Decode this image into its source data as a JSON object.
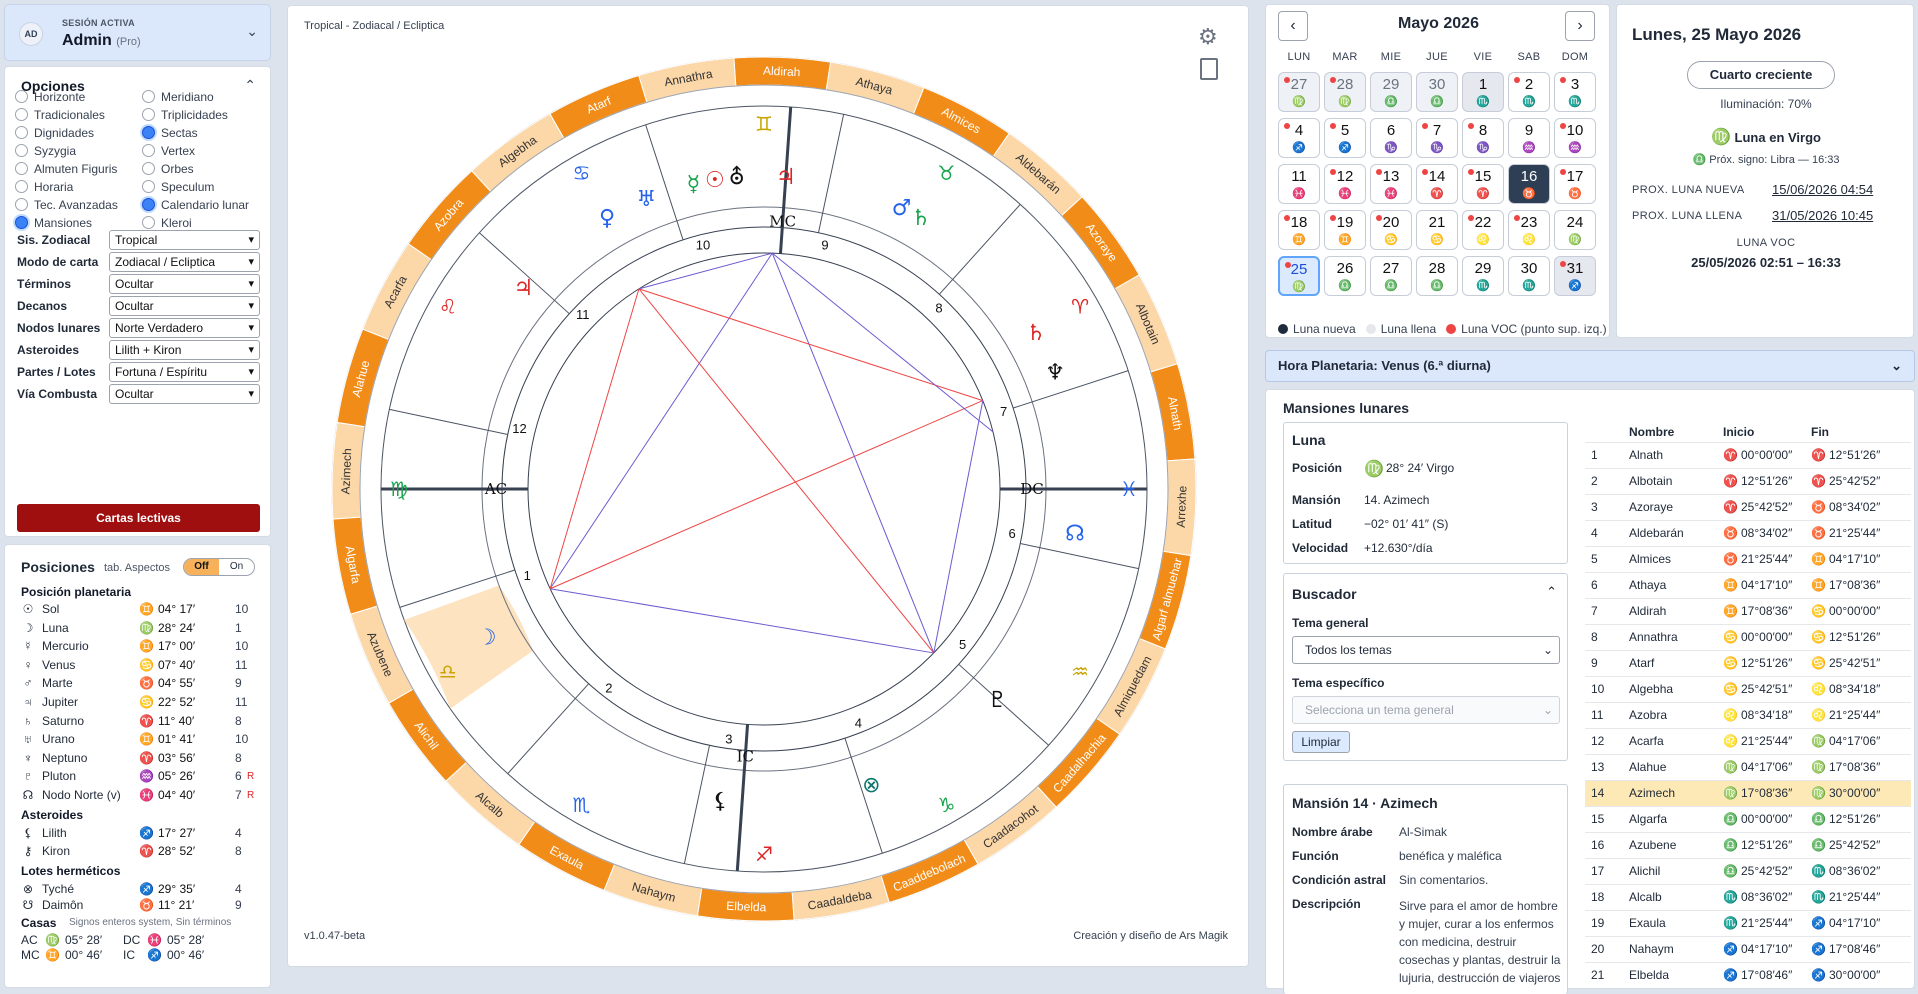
{
  "session": {
    "initials": "AD",
    "label": "SESIÓN ACTIVA",
    "user": "Admin",
    "role": "(Pro)"
  },
  "options": {
    "title": "Opciones",
    "items": [
      {
        "label": "Horizonte",
        "on": false
      },
      {
        "label": "Meridiano",
        "on": false
      },
      {
        "label": "Tradicionales",
        "on": false
      },
      {
        "label": "Triplicidades",
        "on": false
      },
      {
        "label": "Dignidades",
        "on": false
      },
      {
        "label": "Sectas",
        "on": true
      },
      {
        "label": "Syzygia",
        "on": false
      },
      {
        "label": "Vertex",
        "on": false
      },
      {
        "label": "Almuten Figuris",
        "on": false
      },
      {
        "label": "Orbes",
        "on": false
      },
      {
        "label": "Horaria",
        "on": false
      },
      {
        "label": "Speculum",
        "on": false
      },
      {
        "label": "Tec. Avanzadas",
        "on": false
      },
      {
        "label": "Calendario lunar",
        "on": true
      },
      {
        "label": "Mansiones",
        "on": true
      },
      {
        "label": "Kleroi",
        "on": false
      }
    ],
    "selects": [
      {
        "label": "Sis. Zodiacal",
        "value": "Tropical"
      },
      {
        "label": "Modo de carta",
        "value": "Zodiacal / Ecliptica"
      },
      {
        "label": "Términos",
        "value": "Ocultar"
      },
      {
        "label": "Decanos",
        "value": "Ocultar"
      },
      {
        "label": "Nodos lunares",
        "value": "Norte Verdadero"
      },
      {
        "label": "Asteroides",
        "value": "Lilith + Kiron"
      },
      {
        "label": "Partes / Lotes",
        "value": "Fortuna / Espíritu"
      },
      {
        "label": "Vía Combusta",
        "value": "Ocultar"
      }
    ],
    "button": "Cartas lectivas"
  },
  "positions": {
    "title": "Posiciones",
    "aspects_label": "tab. Aspectos",
    "toggle_off": "Off",
    "toggle_on": "On",
    "planet_header": "Posición planetaria",
    "planets": [
      {
        "g": "☉",
        "name": "Sol",
        "z": "♊",
        "zc": "#c9a300",
        "deg": "04° 17′",
        "house": "10",
        "r": ""
      },
      {
        "g": "☽",
        "name": "Luna",
        "z": "♍",
        "zc": "#16a34a",
        "deg": "28° 24′",
        "house": "1",
        "r": ""
      },
      {
        "g": "☿",
        "name": "Mercurio",
        "z": "♊",
        "zc": "#c9a300",
        "deg": "17° 00′",
        "house": "10",
        "r": ""
      },
      {
        "g": "♀",
        "name": "Venus",
        "z": "♋",
        "zc": "#2563eb",
        "deg": "07° 40′",
        "house": "11",
        "r": ""
      },
      {
        "g": "♂",
        "name": "Marte",
        "z": "♉",
        "zc": "#16a34a",
        "deg": "04° 55′",
        "house": "9",
        "r": ""
      },
      {
        "g": "♃",
        "name": "Jupiter",
        "z": "♋",
        "zc": "#2563eb",
        "deg": "22° 52′",
        "house": "11",
        "r": ""
      },
      {
        "g": "♄",
        "name": "Saturno",
        "z": "♈",
        "zc": "#dc2626",
        "deg": "11° 40′",
        "house": "8",
        "r": ""
      },
      {
        "g": "♅",
        "name": "Urano",
        "z": "♊",
        "zc": "#c9a300",
        "deg": "01° 41′",
        "house": "10",
        "r": ""
      },
      {
        "g": "♆",
        "name": "Neptuno",
        "z": "♈",
        "zc": "#dc2626",
        "deg": "03° 56′",
        "house": "8",
        "r": ""
      },
      {
        "g": "♇",
        "name": "Pluton",
        "z": "♒",
        "zc": "#c9a300",
        "deg": "05° 26′",
        "house": "6",
        "r": "R"
      },
      {
        "g": "☊",
        "name": "Nodo Norte (v)",
        "z": "♓",
        "zc": "#2563eb",
        "deg": "04° 40′",
        "house": "7",
        "r": "R"
      }
    ],
    "asteroid_header": "Asteroides",
    "asteroids": [
      {
        "g": "⚸",
        "name": "Lilith",
        "z": "♐",
        "zc": "#dc2626",
        "deg": "17° 27′",
        "house": "4",
        "r": ""
      },
      {
        "g": "⚷",
        "name": "Kiron",
        "z": "♈",
        "zc": "#dc2626",
        "deg": "28° 52′",
        "house": "8",
        "r": ""
      }
    ],
    "lots_header": "Lotes herméticos",
    "lots": [
      {
        "g": "⊗",
        "name": "Tyché",
        "z": "♐",
        "zc": "#dc2626",
        "deg": "29° 35′",
        "house": "4",
        "r": ""
      },
      {
        "g": "☋",
        "name": "Daimôn",
        "z": "♉",
        "zc": "#16a34a",
        "deg": "11° 21′",
        "house": "9",
        "r": ""
      }
    ],
    "houses_header": "Casas",
    "houses_note": "Signos enteros system, Sin términos",
    "angles": [
      {
        "n": "AC",
        "z": "♍",
        "zc": "#16a34a",
        "d": "05° 28′"
      },
      {
        "n": "DC",
        "z": "♓",
        "zc": "#2563eb",
        "d": "05° 28′"
      },
      {
        "n": "MC",
        "z": "♊",
        "zc": "#c9a300",
        "d": "00° 46′"
      },
      {
        "n": "IC",
        "z": "♐",
        "zc": "#dc2626",
        "d": "00° 46′"
      }
    ]
  },
  "chart": {
    "mode_label": "Tropical - Zodiacal / Ecliptica",
    "version": "v1.0.47-beta",
    "credit": "Creación y diseño de Ars Magik",
    "mansions": [
      "Alnath",
      "Albotain",
      "Azoraye",
      "Aldebarán",
      "Almices",
      "Athaya",
      "Aldirah",
      "Annathra",
      "Atarf",
      "Algebha",
      "Azobra",
      "Acarfa",
      "Alahue",
      "Azimech",
      "Algarfa",
      "Azubene",
      "Alichil",
      "Alcalb",
      "Exaula",
      "Nahaym",
      "Elbelda",
      "Caadaldeba",
      "Caaddebolach",
      "Caadacohot",
      "Caadalhachia",
      "Almiquedam",
      "Algarf almuehar",
      "Arrexhe"
    ],
    "houses": [
      "1",
      "2",
      "3",
      "4",
      "5",
      "6",
      "7",
      "8",
      "9",
      "10",
      "11",
      "12"
    ],
    "angles": [
      "AC",
      "DC",
      "MC",
      "IC"
    ]
  },
  "calendar": {
    "month": "Mayo 2026",
    "prev": "‹",
    "next": "›",
    "weekdays": [
      "LUN",
      "MAR",
      "MIE",
      "JUE",
      "VIE",
      "SAB",
      "DOM"
    ],
    "days": [
      {
        "n": "27",
        "z": "♍",
        "t": "other",
        "dot": true
      },
      {
        "n": "28",
        "z": "♍",
        "t": "other",
        "dot": true
      },
      {
        "n": "29",
        "z": "♎",
        "t": "other",
        "dot": false
      },
      {
        "n": "30",
        "z": "♎",
        "t": "other",
        "dot": false
      },
      {
        "n": "1",
        "z": "♏",
        "t": "gray",
        "dot": false
      },
      {
        "n": "2",
        "z": "♏",
        "t": "",
        "dot": true
      },
      {
        "n": "3",
        "z": "♏",
        "t": "",
        "dot": true
      },
      {
        "n": "4",
        "z": "♐",
        "t": "",
        "dot": true
      },
      {
        "n": "5",
        "z": "♐",
        "t": "",
        "dot": true
      },
      {
        "n": "6",
        "z": "♑",
        "t": "",
        "dot": false
      },
      {
        "n": "7",
        "z": "♑",
        "t": "",
        "dot": true
      },
      {
        "n": "8",
        "z": "♑",
        "t": "",
        "dot": true
      },
      {
        "n": "9",
        "z": "♒",
        "t": "",
        "dot": false
      },
      {
        "n": "10",
        "z": "♒",
        "t": "",
        "dot": true
      },
      {
        "n": "11",
        "z": "♓",
        "t": "",
        "dot": false
      },
      {
        "n": "12",
        "z": "♓",
        "t": "",
        "dot": true
      },
      {
        "n": "13",
        "z": "♓",
        "t": "",
        "dot": true
      },
      {
        "n": "14",
        "z": "♈",
        "t": "",
        "dot": true
      },
      {
        "n": "15",
        "z": "♈",
        "t": "",
        "dot": true
      },
      {
        "n": "16",
        "z": "♉",
        "t": "today",
        "dot": false
      },
      {
        "n": "17",
        "z": "♉",
        "t": "",
        "dot": true
      },
      {
        "n": "18",
        "z": "♊",
        "t": "",
        "dot": true
      },
      {
        "n": "19",
        "z": "♊",
        "t": "",
        "dot": true
      },
      {
        "n": "20",
        "z": "♋",
        "t": "",
        "dot": true
      },
      {
        "n": "21",
        "z": "♋",
        "t": "",
        "dot": false
      },
      {
        "n": "22",
        "z": "♌",
        "t": "",
        "dot": true
      },
      {
        "n": "23",
        "z": "♌",
        "t": "",
        "dot": true
      },
      {
        "n": "24",
        "z": "♍",
        "t": "",
        "dot": false
      },
      {
        "n": "25",
        "z": "♍",
        "t": "sel",
        "dot": true
      },
      {
        "n": "26",
        "z": "♎",
        "t": "",
        "dot": false
      },
      {
        "n": "27",
        "z": "♎",
        "t": "",
        "dot": false
      },
      {
        "n": "28",
        "z": "♎",
        "t": "",
        "dot": false
      },
      {
        "n": "29",
        "z": "♏",
        "t": "",
        "dot": false
      },
      {
        "n": "30",
        "z": "♏",
        "t": "",
        "dot": false
      },
      {
        "n": "31",
        "z": "♐",
        "t": "gray",
        "dot": true
      }
    ],
    "legend": {
      "new": "Luna nueva",
      "full": "Luna llena",
      "voc": "Luna VOC (punto sup. izq.)"
    }
  },
  "daybox": {
    "date": "Lunes, 25 Mayo 2026",
    "phase": "Cuarto creciente",
    "illum": "Iluminación: 70%",
    "moon_sign": "Luna en Virgo",
    "next_sign": "Próx. signo: Libra — 16:33",
    "new_label": "PROX. LUNA NUEVA",
    "new_val": "15/06/2026 04:54",
    "full_label": "PROX. LUNA LLENA",
    "full_val": "31/05/2026 10:45",
    "voc_label": "LUNA VOC",
    "voc_val": "25/05/2026 02:51 – 16:33"
  },
  "hora": "Hora Planetaria: Venus (6.ª diurna)",
  "mansions_panel": {
    "title": "Mansiones lunares",
    "luna": {
      "title": "Luna",
      "pos_k": "Posición",
      "pos_v": "28° 24′ Virgo",
      "man_k": "Mansión",
      "man_v": "14. Azimech",
      "lat_k": "Latitud",
      "lat_v": "−02° 01′ 41″ (S)",
      "vel_k": "Velocidad",
      "vel_v": "+12.630°/día"
    },
    "buscador": {
      "title": "Buscador",
      "general_label": "Tema general",
      "general_value": "Todos los temas",
      "specific_label": "Tema específico",
      "specific_placeholder": "Selecciona un tema general",
      "clear": "Limpiar"
    },
    "detail": {
      "title": "Mansión 14 · Azimech",
      "arabic_k": "Nombre árabe",
      "arabic_v": "Al-Simak",
      "func_k": "Función",
      "func_v": "benéfica y maléfica",
      "cond_k": "Condición astral",
      "cond_v": "Sin comentarios.",
      "desc_k": "Descripción",
      "desc_v": "Sirve para el amor de hombre y mujer, curar a los enfermos con medicina, destruir cosechas y plantas, destruir la lujuria, destrucción de viajeros"
    },
    "table_headers": [
      "Nombre",
      "Inicio",
      "Fin"
    ],
    "rows": [
      [
        "1",
        "Alnath",
        "♈",
        "00°00′00″",
        "♈",
        "12°51′26″"
      ],
      [
        "2",
        "Albotain",
        "♈",
        "12°51′26″",
        "♈",
        "25°42′52″"
      ],
      [
        "3",
        "Azoraye",
        "♈",
        "25°42′52″",
        "♉",
        "08°34′02″"
      ],
      [
        "4",
        "Aldebarán",
        "♉",
        "08°34′02″",
        "♉",
        "21°25′44″"
      ],
      [
        "5",
        "Almices",
        "♉",
        "21°25′44″",
        "♊",
        "04°17′10″"
      ],
      [
        "6",
        "Athaya",
        "♊",
        "04°17′10″",
        "♊",
        "17°08′36″"
      ],
      [
        "7",
        "Aldirah",
        "♊",
        "17°08′36″",
        "♋",
        "00°00′00″"
      ],
      [
        "8",
        "Annathra",
        "♋",
        "00°00′00″",
        "♋",
        "12°51′26″"
      ],
      [
        "9",
        "Atarf",
        "♋",
        "12°51′26″",
        "♋",
        "25°42′51″"
      ],
      [
        "10",
        "Algebha",
        "♋",
        "25°42′51″",
        "♌",
        "08°34′18″"
      ],
      [
        "11",
        "Azobra",
        "♌",
        "08°34′18″",
        "♌",
        "21°25′44″"
      ],
      [
        "12",
        "Acarfa",
        "♌",
        "21°25′44″",
        "♍",
        "04°17′06″"
      ],
      [
        "13",
        "Alahue",
        "♍",
        "04°17′06″",
        "♍",
        "17°08′36″"
      ],
      [
        "14",
        "Azimech",
        "♍",
        "17°08′36″",
        "♍",
        "30°00′00″"
      ],
      [
        "15",
        "Algarfa",
        "♎",
        "00°00′00″",
        "♎",
        "12°51′26″"
      ],
      [
        "16",
        "Azubene",
        "♎",
        "12°51′26″",
        "♎",
        "25°42′52″"
      ],
      [
        "17",
        "Alichil",
        "♎",
        "25°42′52″",
        "♏",
        "08°36′02″"
      ],
      [
        "18",
        "Alcalb",
        "♏",
        "08°36′02″",
        "♏",
        "21°25′44″"
      ],
      [
        "19",
        "Exaula",
        "♏",
        "21°25′44″",
        "♐",
        "04°17′10″"
      ],
      [
        "20",
        "Nahaym",
        "♐",
        "04°17′10″",
        "♐",
        "17°08′46″"
      ],
      [
        "21",
        "Elbelda",
        "♐",
        "17°08′46″",
        "♐",
        "30°00′00″"
      ]
    ]
  }
}
